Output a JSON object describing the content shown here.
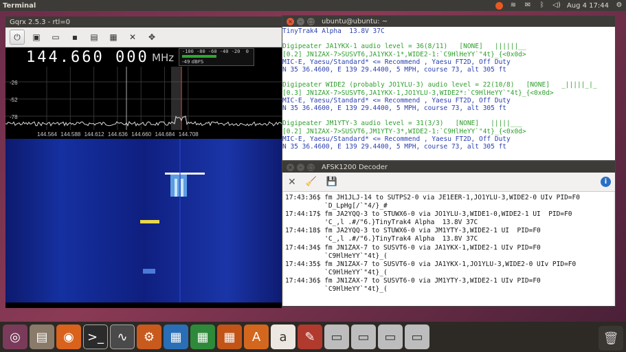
{
  "top_panel": {
    "title": "Terminal",
    "tray": {
      "ubuntu_one": "",
      "network": "≋",
      "mail": "✉",
      "bluetooth": "ᛒ",
      "volume": "◁)",
      "clock": "Aug 4 17:44",
      "gear": "⚙"
    }
  },
  "gqrx": {
    "title": "Gqrx 2.5.3 - rtl=0",
    "frequency": "144.660 000",
    "unit": "MHz",
    "smeter": {
      "scale": "-100 -80 -60 -40 -20  0",
      "readout": "-49 dBFS",
      "level_fraction": 0.5
    },
    "plotter": {
      "y_labels": [
        "-26",
        "-52",
        "-78"
      ],
      "x_labels": [
        "144.564",
        "144.588",
        "144.612",
        "144.636",
        "144.660",
        "144.684",
        "144.708"
      ]
    }
  },
  "terminal": {
    "title": "ubuntu@ubuntu: ~",
    "lines": [
      {
        "text": "TinyTrak4 Alpha  13.8V 37C",
        "color": "blue"
      },
      {
        "text": "",
        "color": "gap"
      },
      {
        "text": "Digipeater JA1YKX-1 audio level = 36(8/11)   [NONE]   ||||||__",
        "color": "green"
      },
      {
        "text": "[0.2] JN1ZAX-7>SUSVT6,JA1YKX-1*,WIDE2-1:`C9HlHeYY`\"4t}_{<0x0d>",
        "color": "green"
      },
      {
        "text": "MIC-E, Yaesu/Standard* <= Recommend , Yaesu FT2D, Off Duty",
        "color": "blue"
      },
      {
        "text": "N 35 36.4600, E 139 29.4400, 5 MPH, course 73, alt 305 ft",
        "color": "blue"
      },
      {
        "text": "",
        "color": "gap"
      },
      {
        "text": "Digipeater WIDE2 (probably JO1YLU-3) audio level = 22(10/8)   [NONE]   _|||||_|_",
        "color": "green"
      },
      {
        "text": "[0.3] JN1ZAX-7>SUSVT6,JA1YKX-1,JO1YLU-3,WIDE2*:`C9HlHeYY`\"4t}_{<0x0d>",
        "color": "green"
      },
      {
        "text": "MIC-E, Yaesu/Standard* <= Recommend , Yaesu FT2D, Off Duty",
        "color": "blue"
      },
      {
        "text": "N 35 36.4600, E 139 29.4400, 5 MPH, course 73, alt 305 ft",
        "color": "blue"
      },
      {
        "text": "",
        "color": "gap"
      },
      {
        "text": "Digipeater JM1YTY-3 audio level = 31(3/3)   [NONE]   |||||___",
        "color": "green"
      },
      {
        "text": "[0.2] JN1ZAX-7>SUSVT6,JM1YTY-3*,WIDE2-1:`C9HlHeYY`\"4t}_{<0x0d>",
        "color": "green"
      },
      {
        "text": "MIC-E, Yaesu/Standard* <= Recommend , Yaesu FT2D, Off Duty",
        "color": "blue"
      },
      {
        "text": "N 35 36.4600, E 139 29.4400, 5 MPH, course 73, alt 305 ft",
        "color": "blue"
      }
    ]
  },
  "afsk": {
    "title": "AFSK1200 Decoder",
    "toolbar": {
      "clear": "✕",
      "brush": "🧹",
      "save": "💾",
      "info": "i"
    },
    "lines": [
      "17:43:36$ fm JH1JLJ-14 to SUTPS2-0 via JE1EER-1,JO1YLU-3,WIDE2-0 UIv PID=F0",
      "          `D_LpHg[/`\"4/}_#",
      "17:44:17$ fm JA2YQQ-3 to STUWX6-0 via JO1YLU-3,WIDE1-0,WIDE2-1 UI  PID=F0",
      "          'C_,l .#/\"6.}TinyTrak4 Alpha  13.8V 37C",
      "17:44:18$ fm JA2YQQ-3 to STUWX6-0 via JM1YTY-3,WIDE2-1 UI  PID=F0",
      "          'C_,l .#/\"6.}TinyTrak4 Alpha  13.8V 37C",
      "17:44:34$ fm JN1ZAX-7 to SUSVT6-0 via JA1YKX-1,WIDE2-1 UIv PID=F0",
      "          `C9HlHeYY`\"4t}_(",
      "17:44:35$ fm JN1ZAX-7 to SUSVT6-0 via JA1YKX-1,JO1YLU-3,WIDE2-0 UIv PID=F0",
      "          `C9HlHeYY`\"4t}_(",
      "17:44:36$ fm JN1ZAX-7 to SUSVT6-0 via JM1YTY-3,WIDE2-1 UIv PID=F0",
      "          `C9HlHeYY`\"4t}_("
    ]
  },
  "launcher": [
    {
      "name": "dash",
      "glyph": "◎",
      "color": "#7a3b5a"
    },
    {
      "name": "files",
      "glyph": "▤",
      "color": "#8a7a6a"
    },
    {
      "name": "firefox",
      "glyph": "◉",
      "color": "#d9621c"
    },
    {
      "name": "terminal",
      "glyph": ">_",
      "color": "#2b2b2b",
      "active": true
    },
    {
      "name": "gqrx",
      "glyph": "∿",
      "color": "#4a4a4a",
      "active": true
    },
    {
      "name": "unity-settings",
      "glyph": "⚙",
      "color": "#c85a1e"
    },
    {
      "name": "writer",
      "glyph": "▦",
      "color": "#2a6fb5"
    },
    {
      "name": "calc",
      "glyph": "▦",
      "color": "#2e8a3a"
    },
    {
      "name": "impress",
      "glyph": "▦",
      "color": "#c25418"
    },
    {
      "name": "software-center",
      "glyph": "A",
      "color": "#d4671e"
    },
    {
      "name": "amazon",
      "glyph": "a",
      "color": "#ece8e1"
    },
    {
      "name": "system-settings",
      "glyph": "✎",
      "color": "#b03a2e"
    },
    {
      "name": "drive-1",
      "glyph": "▭",
      "color": "#bdbdbd"
    },
    {
      "name": "drive-2",
      "glyph": "▭",
      "color": "#bdbdbd"
    },
    {
      "name": "drive-3",
      "glyph": "▭",
      "color": "#bdbdbd"
    },
    {
      "name": "drive-4",
      "glyph": "▭",
      "color": "#bdbdbd"
    }
  ],
  "trash_glyph": "🗑"
}
